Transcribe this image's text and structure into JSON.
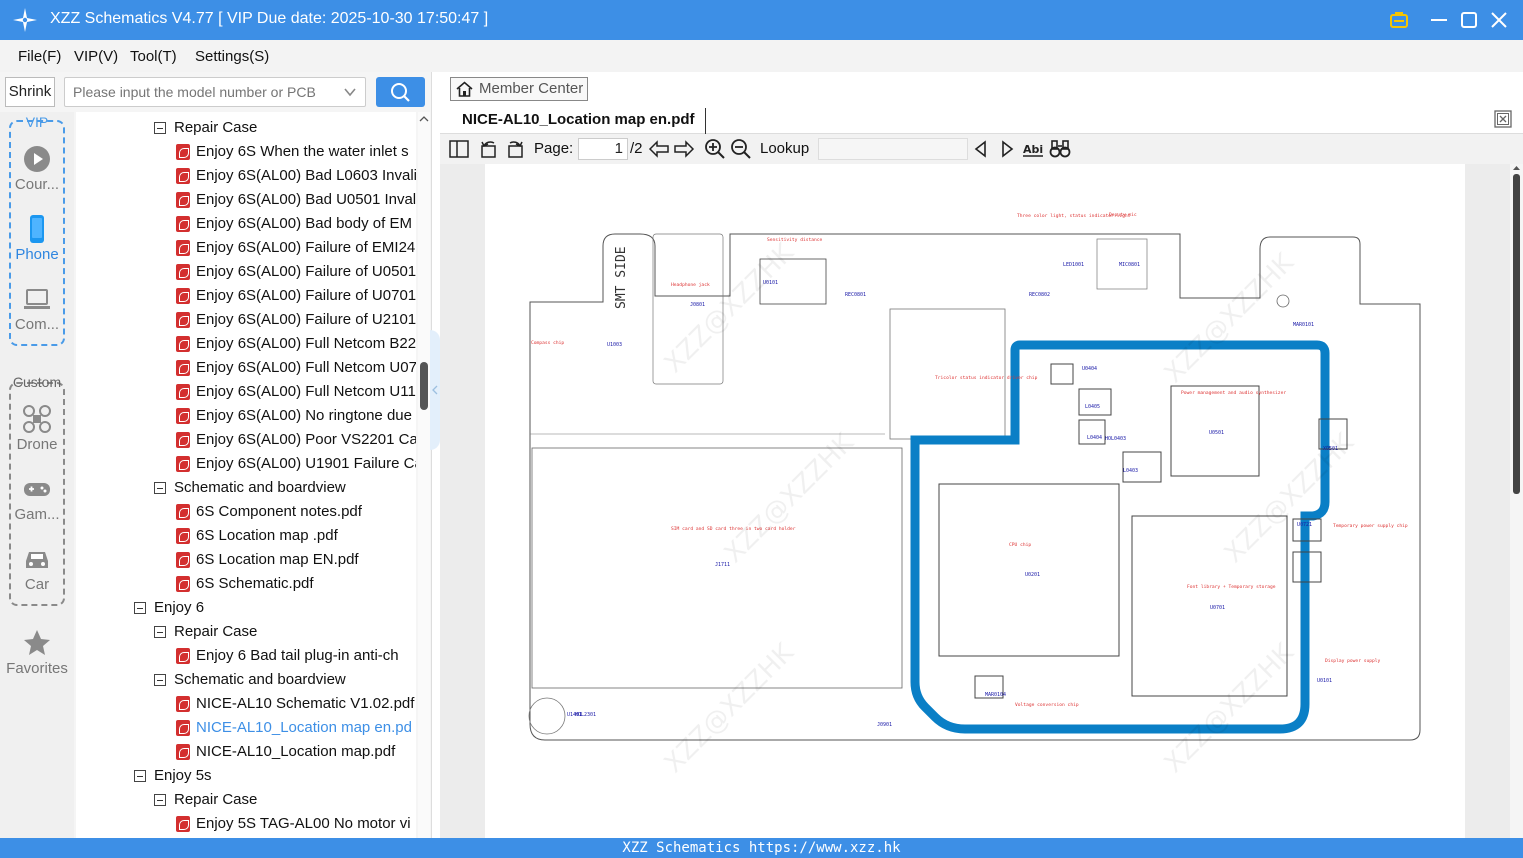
{
  "app": {
    "title": "XZZ Schematics V4.77 [ VIP Due date: 2025-10-30 17:50:47 ]",
    "status": "XZZ Schematics https://www.xzz.hk"
  },
  "menu": [
    "File(F)",
    "VIP(V)",
    "Tool(T)",
    "Settings(S)"
  ],
  "search": {
    "shrink_label": "Shrink",
    "placeholder": "Please input the model number or PCB",
    "button_icon": "search-icon"
  },
  "sidenav": {
    "vip_label": "VIP",
    "custom_label": "Custom",
    "items": [
      {
        "label": "Cour...",
        "icon": "play-icon"
      },
      {
        "label": "Phone",
        "icon": "phone-icon"
      },
      {
        "label": "Com...",
        "icon": "laptop-icon"
      },
      {
        "label": "Drone",
        "icon": "drone-icon"
      },
      {
        "label": "Gam...",
        "icon": "gamepad-icon"
      },
      {
        "label": "Car",
        "icon": "car-icon"
      },
      {
        "label": "Favorites",
        "icon": "star-icon"
      }
    ]
  },
  "tree": [
    {
      "level": 2,
      "type": "folder",
      "label": "Repair Case"
    },
    {
      "level": 3,
      "type": "pdf",
      "label": "Enjoy 6S When the water inlet s"
    },
    {
      "level": 3,
      "type": "pdf",
      "label": "Enjoy 6S(AL00) Bad L0603 Invali"
    },
    {
      "level": 3,
      "type": "pdf",
      "label": "Enjoy 6S(AL00) Bad U0501 Inval"
    },
    {
      "level": 3,
      "type": "pdf",
      "label": "Enjoy 6S(AL00) Bad body of EM"
    },
    {
      "level": 3,
      "type": "pdf",
      "label": "Enjoy 6S(AL00) Failure of EMI24"
    },
    {
      "level": 3,
      "type": "pdf",
      "label": "Enjoy 6S(AL00) Failure of U0501"
    },
    {
      "level": 3,
      "type": "pdf",
      "label": "Enjoy 6S(AL00) Failure of U0701"
    },
    {
      "level": 3,
      "type": "pdf",
      "label": "Enjoy 6S(AL00) Failure of U2101"
    },
    {
      "level": 3,
      "type": "pdf",
      "label": "Enjoy 6S(AL00) Full Netcom B22"
    },
    {
      "level": 3,
      "type": "pdf",
      "label": "Enjoy 6S(AL00) Full Netcom U07"
    },
    {
      "level": 3,
      "type": "pdf",
      "label": "Enjoy 6S(AL00) Full Netcom U11"
    },
    {
      "level": 3,
      "type": "pdf",
      "label": "Enjoy 6S(AL00) No ringtone due"
    },
    {
      "level": 3,
      "type": "pdf",
      "label": "Enjoy 6S(AL00) Poor VS2201 Ca"
    },
    {
      "level": 3,
      "type": "pdf",
      "label": "Enjoy 6S(AL00) U1901 Failure Ca"
    },
    {
      "level": 2,
      "type": "folder",
      "label": "Schematic and boardview"
    },
    {
      "level": 3,
      "type": "pdf",
      "label": "6S Component notes.pdf"
    },
    {
      "level": 3,
      "type": "pdf",
      "label": "6S Location map .pdf"
    },
    {
      "level": 3,
      "type": "pdf",
      "label": "6S Location map EN.pdf"
    },
    {
      "level": 3,
      "type": "pdf",
      "label": "6S Schematic.pdf"
    },
    {
      "level": 1,
      "type": "folder",
      "label": "Enjoy 6"
    },
    {
      "level": 2,
      "type": "folder",
      "label": "Repair Case"
    },
    {
      "level": 3,
      "type": "pdf",
      "label": "Enjoy 6 Bad tail plug-in anti-ch"
    },
    {
      "level": 2,
      "type": "folder",
      "label": "Schematic and boardview"
    },
    {
      "level": 3,
      "type": "pdf",
      "label": "NICE-AL10 Schematic V1.02.pdf"
    },
    {
      "level": 3,
      "type": "pdf",
      "label": "NICE-AL10_Location map en.pd",
      "selected": true
    },
    {
      "level": 3,
      "type": "pdf",
      "label": "NICE-AL10_Location map.pdf"
    },
    {
      "level": 1,
      "type": "folder",
      "label": "Enjoy 5s"
    },
    {
      "level": 2,
      "type": "folder",
      "label": "Repair Case"
    },
    {
      "level": 3,
      "type": "pdf",
      "label": "Enjoy 5S TAG-AL00 No motor vi"
    }
  ],
  "viewer": {
    "member_center": "Member Center",
    "doc_tab": "NICE-AL10_Location map en.pdf",
    "page_label": "Page:",
    "page_current": "1",
    "page_total": "/2",
    "lookup_label": "Lookup",
    "accent": "#0a7fc6"
  },
  "board": {
    "smt_side": "SMT SIDE",
    "watermark": "XZZ@XZZHK",
    "notes": [
      "Three color light, status indicator light",
      "Deputy mic",
      "Sensitivity distance",
      "Headphone jack",
      "Compass chip",
      "Tricolor status indicator driver chip",
      "Power management and audio synthesizer",
      "SIM card and SD card three in two card holder",
      "CPU chip",
      "Font library + Temporary storage",
      "Temporary power supply chip",
      "Display power supply",
      "Voltage conversion chip"
    ],
    "parts": [
      "U0101",
      "REC0801",
      "LED1001",
      "MIC0801",
      "REC0802",
      "MAR0101",
      "U1003",
      "J0801",
      "J1711",
      "U0201",
      "U0501",
      "U0701",
      "U0721",
      "L0405",
      "L0404",
      "L0403",
      "U0404",
      "U1401",
      "HOL2301",
      "J0901",
      "MAR0104",
      "U0101",
      "HOL0403",
      "XO501"
    ]
  }
}
